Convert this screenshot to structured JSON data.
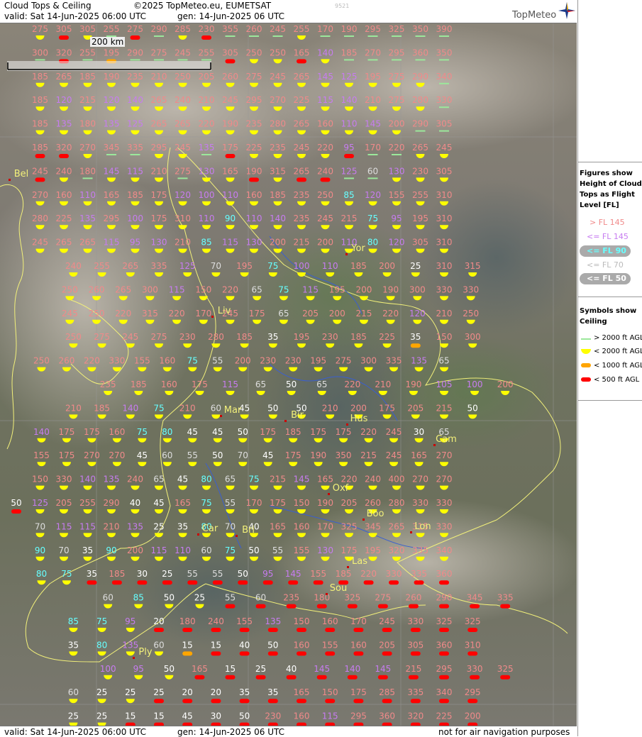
{
  "header": {
    "title": "Cloud Tops & Ceiling",
    "copyright": "©2025 TopMeteo.eu, EUMETSAT",
    "valid": "valid:  Sat  14-Jun-2025  06:00 UTC",
    "gen": "gen: 14-Jun-2025 06 UTC",
    "code": "9521",
    "logo": "TopMeteo"
  },
  "footer": {
    "valid": "valid:  Sat  14-Jun-2025  06:00 UTC",
    "gen": "gen: 14-Jun-2025 06 UTC",
    "disclaimer": "not for air navigation purposes"
  },
  "scale": {
    "label": "200 km"
  },
  "legend": {
    "tops_title": "Figures show Height of Cloud Tops as Flight Level  [FL]",
    "tops_items": [
      {
        "label": "> FL 145",
        "color": "#f08a8a"
      },
      {
        "label": "<= FL 145",
        "color": "#c77cf0"
      },
      {
        "label": "<= FL 90",
        "color": "#6ff"
      },
      {
        "label": "<= FL 70",
        "color": "#bbbbbb"
      },
      {
        "label": "<= FL 50",
        "color": "#ffffff"
      }
    ],
    "ceiling_title": "Symbols show Ceiling",
    "ceiling_items": [
      {
        "label": "> 2000 ft AGL",
        "color": "#9be89b"
      },
      {
        "label": "< 2000 ft AGL",
        "color": "#ffff00"
      },
      {
        "label": "< 1000 ft AGL",
        "color": "#ffa500"
      },
      {
        "label": "< 500 ft AGL",
        "color": "#ff0000"
      }
    ]
  },
  "colors": {
    "high": "#f08a8a",
    "mid": "#c77cf0",
    "low90": "#66ffff",
    "low50": "#ffffff",
    "c_green": "#9be89b",
    "c_yellow": "#ffff00",
    "c_orange": "#ffa500",
    "c_red": "#ff0000"
  },
  "cities": [
    {
      "name": "Yor"
    },
    {
      "name": "Liv"
    },
    {
      "name": "Mar"
    },
    {
      "name": "Bir"
    },
    {
      "name": "Hus"
    },
    {
      "name": "Cam"
    },
    {
      "name": "Oxf"
    },
    {
      "name": "Boo"
    },
    {
      "name": "Lon"
    },
    {
      "name": "Car"
    },
    {
      "name": "Bri"
    },
    {
      "name": "Las"
    },
    {
      "name": "Sou"
    },
    {
      "name": "Bel"
    },
    {
      "name": "Ply"
    }
  ],
  "grid": {
    "cols": 25,
    "rows": [
      [
        "275:y",
        "305:r",
        "305:y",
        "255:g",
        "275:r",
        "290:g",
        "285:y",
        "230:r",
        "355:g",
        "260:g",
        "245:g",
        "255:y",
        "170:g",
        "190:g",
        "295:g",
        "325:g",
        "350:g",
        "390:g"
      ],
      [
        "300:g",
        "320:r",
        "255:g",
        "195:o",
        "290:g",
        "275:g",
        "245:g",
        "255:g",
        "305:r",
        "250:y",
        "250:y",
        "165:r",
        "140:y",
        "185:g",
        "270:g",
        "295:g",
        "360:g",
        "350:g"
      ],
      [
        "185:y",
        "265:y",
        "185:y",
        "190:y",
        "235:y",
        "210:y",
        "250:y",
        "205:y",
        "260:y",
        "275:y",
        "245:y",
        "265:y",
        "145:y",
        "125:y",
        "195:y",
        "275:y",
        "290:y",
        "340:g"
      ],
      [
        "185:y",
        "120:y",
        "215:y",
        "120:y",
        "140:y",
        "265:y",
        "240:y",
        "210:y",
        "245:y",
        "295:y",
        "270:y",
        "225:y",
        "115:y",
        "140:y",
        "210:y",
        "275:y",
        "280:y",
        "330:g"
      ],
      [
        "185:y",
        "135:y",
        "180:y",
        "135:y",
        "125:y",
        "265:y",
        "265:y",
        "220:y",
        "190:y",
        "235:y",
        "280:y",
        "265:y",
        "160:y",
        "110:y",
        "145:y",
        "200:y",
        "290:g",
        "305:g"
      ],
      [
        "185:r",
        "320:r",
        "270:y",
        "345:g",
        "335:g",
        "295:y",
        "245:y",
        "135:g",
        "175:r",
        "225:y",
        "235:y",
        "245:y",
        "220:y",
        "95:r",
        "170:g",
        "220:g",
        "265:y",
        "245:y"
      ],
      [
        "245:r",
        "240:y",
        "180:g",
        "145:y",
        "115:y",
        "210:y",
        "275:g",
        "130:y",
        "165:y",
        "190:r",
        "315:y",
        "265:r",
        "240:r",
        "125:g",
        "60:g",
        "130:y",
        "230:y",
        "305:y"
      ],
      [
        "270:y",
        "160:y",
        "110:y",
        "165:y",
        "185:y",
        "175:y",
        "120:y",
        "100:y",
        "110:y",
        "160:y",
        "185:y",
        "235:y",
        "250:y",
        "85:y",
        "120:y",
        "155:y",
        "255:y",
        "310:y"
      ],
      [
        "280:y",
        "225:y",
        "135:y",
        "295:y",
        "100:y",
        "175:y",
        "310:y",
        "110:y",
        "90:y",
        "110:y",
        "140:y",
        "235:y",
        "245:y",
        "215:y",
        "75:y",
        "95:y",
        "195:y",
        "310:y"
      ],
      [
        "245:y",
        "265:y",
        "265:y",
        "115:y",
        "95:y",
        "130:y",
        "210:y",
        "85:y",
        "115:y",
        "130:y",
        "200:y",
        "215:y",
        "200:y",
        "110:y",
        "80:y",
        "120:y",
        "305:y",
        "310:y"
      ],
      [
        "240:y",
        "255:y",
        "265:y",
        "335:y",
        "125:y",
        "70:y",
        "195:y",
        "75:y",
        "100:y",
        "110:y",
        "185:y",
        "200:y",
        "25:y",
        "310:y",
        "315:y"
      ],
      [
        "250:y",
        "260:y",
        "265:y",
        "300:y",
        "115:y",
        "150:y",
        "220:y",
        "65:y",
        "75:y",
        "115:y",
        "195:y",
        "200:y",
        "190:y",
        "300:y",
        "330:y",
        "330:y"
      ],
      [
        "245:y",
        "250:y",
        "220:y",
        "315:y",
        "220:y",
        "170:y",
        "245:y",
        "175:y",
        "65:y",
        "205:y",
        "200:y",
        "215:y",
        "220:y",
        "120:y",
        "210:y",
        "250:y"
      ],
      [
        "250:y",
        "275:y",
        "245:y",
        "275:y",
        "230:y",
        "280:y",
        "185:y",
        "35:y",
        "195:y",
        "230:y",
        "185:y",
        "225:y",
        "35:o",
        "150:y",
        "300:y"
      ],
      [
        "250:y",
        "260:y",
        "220:y",
        "330:y",
        "155:y",
        "160:y",
        "75:y",
        "55:y",
        "200:y",
        "230:y",
        "230:y",
        "195:y",
        "275:y",
        "300:y",
        "335:y",
        "135:y",
        "65:y"
      ],
      [
        "235:y",
        "185:y",
        "160:y",
        "175:y",
        "115:y",
        "65:y",
        "50:y",
        "65:y",
        "220:y",
        "210:y",
        "190:y",
        "105:y",
        "100:y",
        "200:y"
      ],
      [
        "210:y",
        "185:y",
        "140:y",
        "75:y",
        "210:y",
        "60:y",
        "45:y",
        "50:y",
        "50:y",
        "210:y",
        "200:y",
        "175:y",
        "205:y",
        "215:y",
        "50:y"
      ],
      [
        "140:y",
        "175:y",
        "175:y",
        "160:y",
        "75:y",
        "80:y",
        "45:y",
        "45:y",
        "50:y",
        "175:y",
        "185:y",
        "175:y",
        "175:y",
        "220:y",
        "245:y",
        "30:y",
        "65:y"
      ],
      [
        "155:y",
        "175:y",
        "270:y",
        "270:y",
        "45:y",
        "60:y",
        "55:y",
        "50:y",
        "70:y",
        "45:y",
        "175:y",
        "190:y",
        "350:y",
        "215:y",
        "245:y",
        "165:y",
        "270:y"
      ],
      [
        "150:y",
        "330:y",
        "140:y",
        "135:y",
        "240:y",
        "65:y",
        "45:y",
        "80:y",
        "65:y",
        "75:y",
        "215:y",
        "145:y",
        "165:y",
        "220:y",
        "240:y",
        "400:y",
        "270:y",
        "270:y"
      ],
      [
        "50:r",
        "125:y",
        "205:y",
        "255:y",
        "290:y",
        "40:y",
        "45:y",
        "165:y",
        "75:y",
        "55:y",
        "170:y",
        "175:y",
        "150:y",
        "190:y",
        "205:y",
        "260:y",
        "280:y",
        "330:y",
        "330:y"
      ],
      [
        "70:y",
        "115:y",
        "115:y",
        "210:y",
        "135:y",
        "25:y",
        "35:y",
        "80:y",
        "70:y",
        "40:y",
        "165:y",
        "160:y",
        "170:y",
        "325:y",
        "345:y",
        "265:y",
        "315:y",
        "330:y"
      ],
      [
        "90:y",
        "70:y",
        "35:y",
        "90:y",
        "200:y",
        "115:y",
        "110:y",
        "60:y",
        "75:y",
        "50:y",
        "55:y",
        "155:y",
        "130:y",
        "175:y",
        "195:y",
        "320:y",
        "335:y",
        "340:y"
      ],
      [
        "80:y",
        "75:y",
        "35:r",
        "185:r",
        "30:r",
        "25:r",
        "55:r",
        "55:r",
        "50:r",
        "95:r",
        "145:r",
        "155:r",
        "185:r",
        "220:r",
        "330:r",
        "335:r",
        "360:r"
      ],
      [
        "60:y",
        "85:y",
        "50:y",
        "25:y",
        "55:r",
        "60:r",
        "235:r",
        "180:r",
        "325:r",
        "275:r",
        "260:r",
        "290:r",
        "345:r",
        "335:r"
      ],
      [
        "85:y",
        "75:y",
        "95:y",
        "20:r",
        "180:r",
        "240:r",
        "155:r",
        "135:r",
        "150:r",
        "160:r",
        "170:r",
        "245:r",
        "330:r",
        "325:r",
        "325:r"
      ],
      [
        "35:y",
        "80:y",
        "135:y",
        "60:y",
        "15:o",
        "15:r",
        "40:r",
        "50:r",
        "160:r",
        "155:r",
        "160:r",
        "205:r",
        "305:r",
        "360:r",
        "310:r"
      ],
      [
        "100:y",
        "95:y",
        "50:y",
        "165:r",
        "15:r",
        "25:r",
        "40:r",
        "145:r",
        "140:r",
        "145:r",
        "215:r",
        "295:r",
        "330:r",
        "325:r"
      ],
      [
        "60:y",
        "25:y",
        "25:y",
        "25:r",
        "20:r",
        "20:r",
        "35:r",
        "35:r",
        "165:r",
        "150:r",
        "175:r",
        "285:r",
        "335:r",
        "340:r",
        "295:r"
      ],
      [
        "25:y",
        "25:y",
        "15:r",
        "15:r",
        "45:r",
        "30:r",
        "50:r",
        "230:r",
        "160:r",
        "115:r",
        "295:r",
        "360:r",
        "320:r",
        "225:r",
        "200:r"
      ]
    ]
  }
}
